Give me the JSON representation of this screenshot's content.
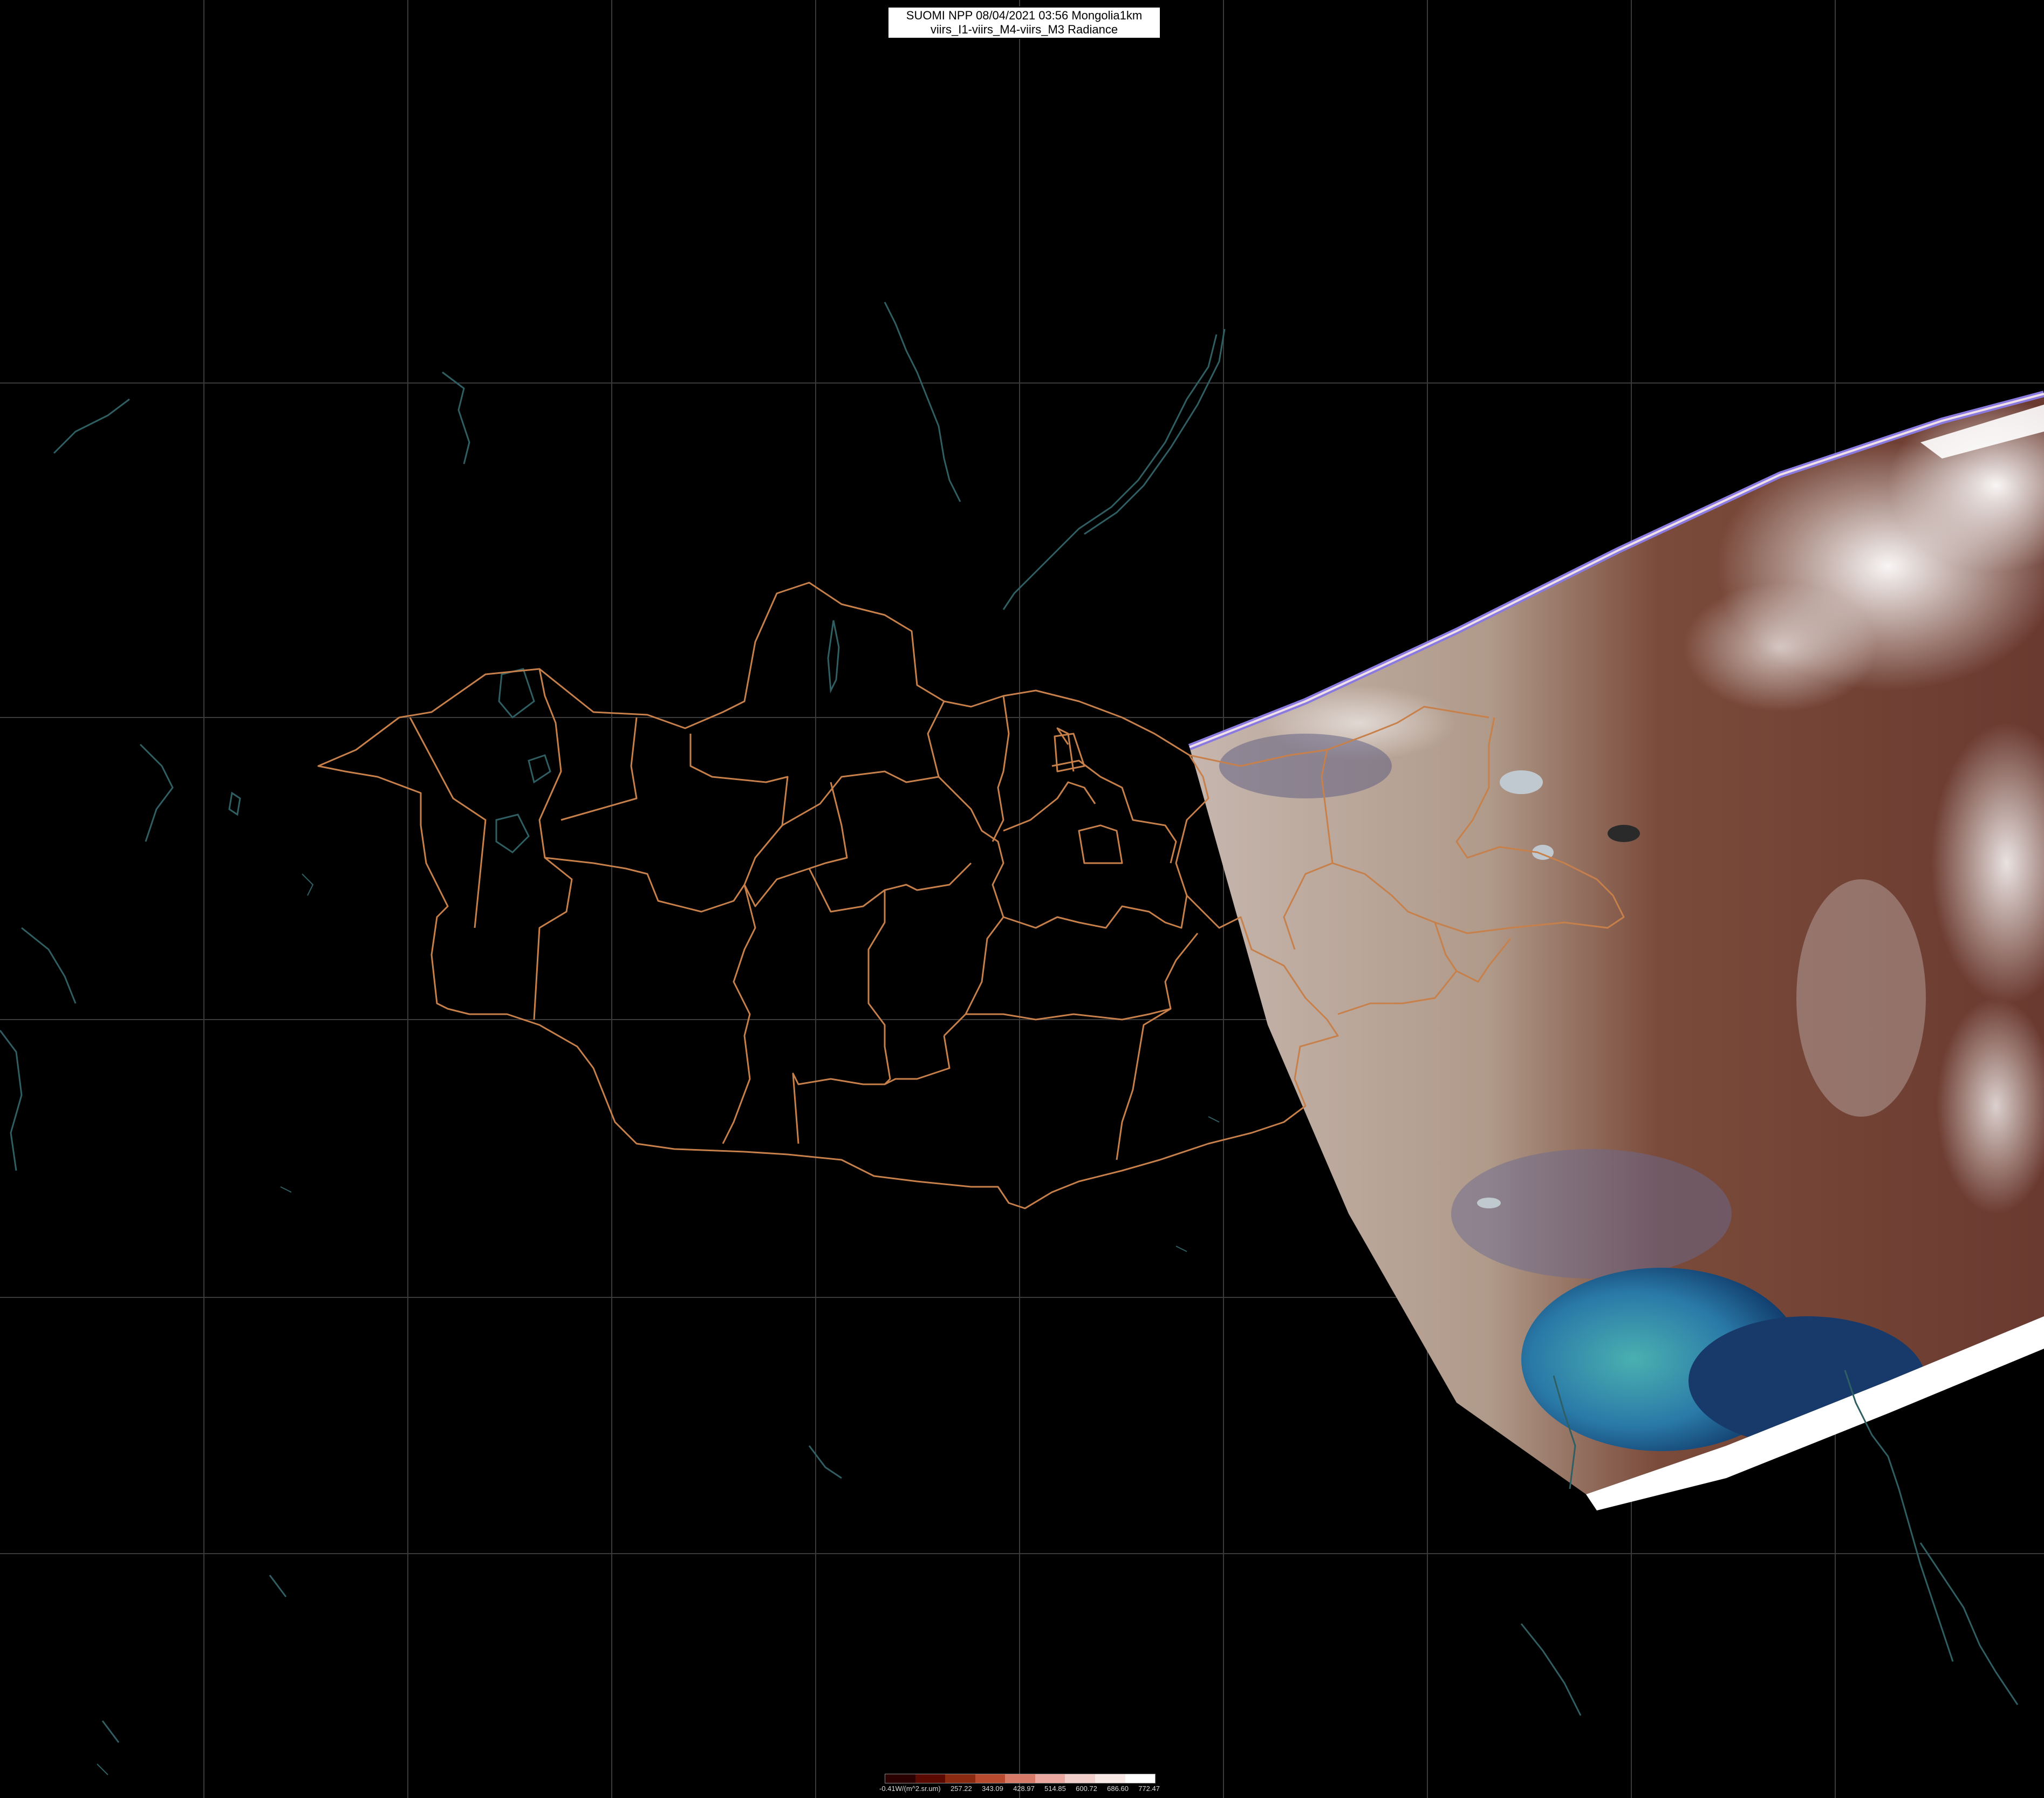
{
  "title": {
    "line1": "SUOMI NPP 08/04/2021 03:56 Mongolia1km",
    "line2": "viirs_I1-viirs_M4-viirs_M3 Radiance"
  },
  "colorbar": {
    "unit_label": "-0.41W/(m^2.sr.um)",
    "ticks": [
      "257.22",
      "343.09",
      "428.97",
      "514.85",
      "600.72",
      "686.60",
      "772.47"
    ],
    "colors": [
      "#2a0000",
      "#5a0a00",
      "#8a2a10",
      "#b84a30",
      "#d87a68",
      "#eaa8a0",
      "#f2cfca",
      "#f8e8e6",
      "#ffffff"
    ]
  },
  "map_colors": {
    "background": "#000000",
    "graticule": "#3a3a3a",
    "admin_border": "#c8804a",
    "coastline": "#2f5f63",
    "swath_land": "#7a5a48",
    "swath_desert": "#b8a898",
    "swath_sea": "#2a7aa0",
    "swath_edge": "#8a7ae0"
  },
  "icons": [
    "satellite-swath",
    "province-border",
    "coastline",
    "graticule"
  ]
}
